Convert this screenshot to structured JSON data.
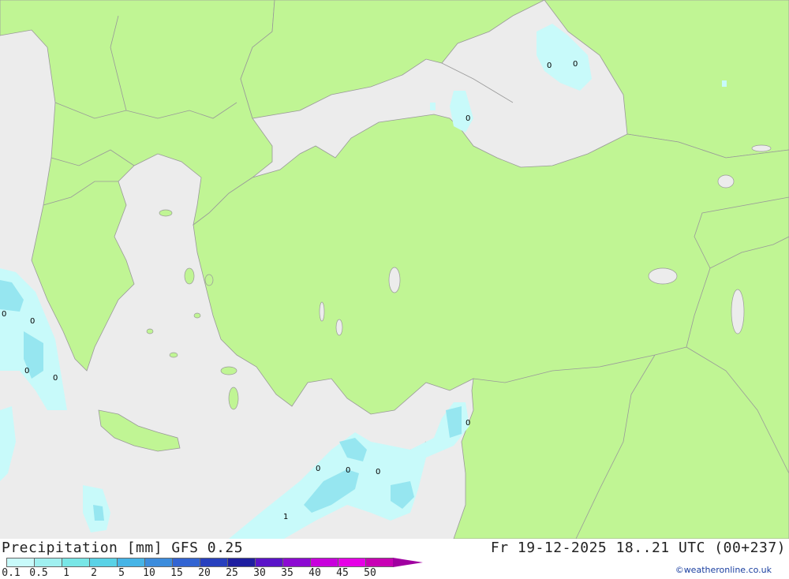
{
  "title": {
    "left": "Precipitation [mm] GFS 0.25",
    "right": "Fr 19-12-2025 18..21 UTC (00+237)"
  },
  "legend": {
    "ticks": [
      "0.1",
      "0.5",
      "1",
      "2",
      "5",
      "10",
      "15",
      "20",
      "25",
      "30",
      "35",
      "40",
      "45",
      "50"
    ],
    "colors": [
      "#c8fafa",
      "#a0f0f0",
      "#78e6e6",
      "#5ad2e6",
      "#46b4e6",
      "#3c8cdc",
      "#3264d2",
      "#2840be",
      "#1e1ea0",
      "#5a14c8",
      "#8c0ad2",
      "#c800dc",
      "#e600e6",
      "#c800b4"
    ],
    "arrow_color": "#a000a0"
  },
  "credit": "©weatheronline.co.uk",
  "map_colors": {
    "sea": "#ececec",
    "land": "#c0f594",
    "border": "#999999",
    "precip_light": "#c8fafa",
    "precip_mid": "#96e6f0",
    "precip_dark": "#5ad2e6"
  },
  "point_values": [
    {
      "label": "0"
    },
    {
      "label": "0"
    },
    {
      "label": "0"
    },
    {
      "label": "0"
    },
    {
      "label": "0"
    },
    {
      "label": "0"
    },
    {
      "label": "0"
    },
    {
      "label": "0"
    },
    {
      "label": "0"
    },
    {
      "label": "0"
    },
    {
      "label": "0"
    },
    {
      "label": "1"
    }
  ]
}
